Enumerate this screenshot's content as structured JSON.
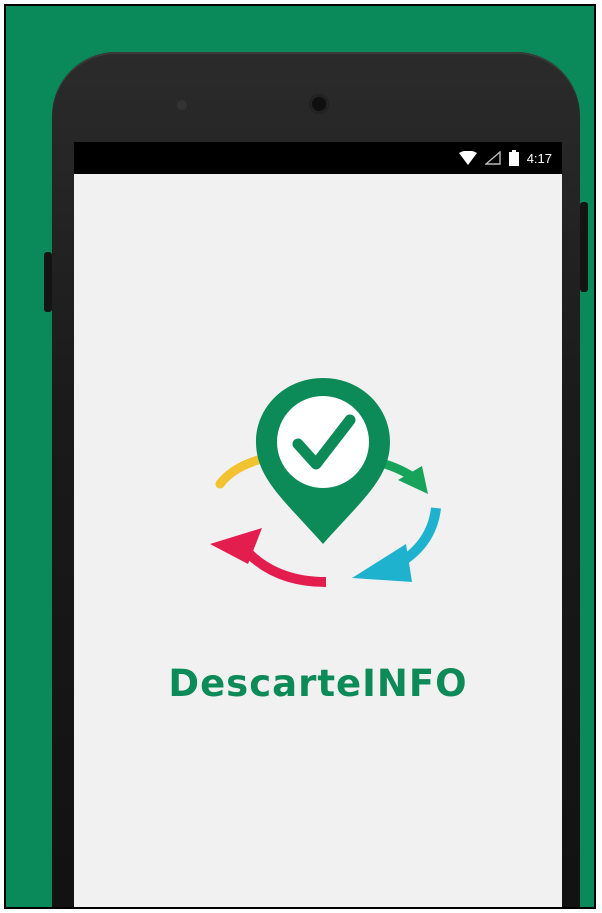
{
  "colors": {
    "background": "#0a8a5a",
    "brand_green": "#0c8a57",
    "screen": "#f1f1f2",
    "arrow_yellow": "#f2c230",
    "arrow_red": "#e41d4f",
    "arrow_blue": "#1fb2cf",
    "arrow_green": "#17a35a"
  },
  "status_bar": {
    "time": "4:17",
    "icons": [
      "wifi-icon",
      "signal-icon",
      "battery-icon"
    ]
  },
  "app": {
    "name": "DescarteINFO",
    "logo_icon": "location-pin-check-recycle-icon"
  }
}
